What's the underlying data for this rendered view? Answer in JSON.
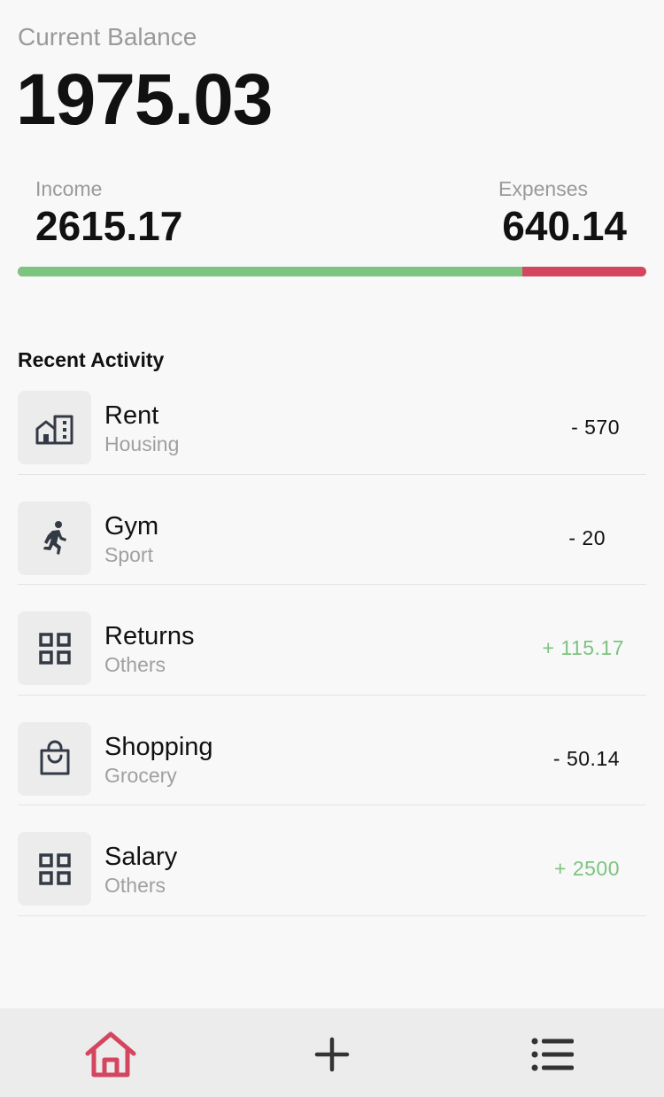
{
  "balance": {
    "label": "Current Balance",
    "value": "1975.03"
  },
  "summary": {
    "income_label": "Income",
    "income_value": "2615.17",
    "expenses_label": "Expenses",
    "expenses_value": "640.14",
    "income_fraction": 0.8034,
    "income_color": "#7cc47f",
    "expense_color": "#d4465f"
  },
  "recent_activity": {
    "title": "Recent Activity",
    "items": [
      {
        "name": "Rent",
        "category": "Housing",
        "amount": "- 570",
        "icon": "building-icon",
        "positive": false
      },
      {
        "name": "Gym",
        "category": "Sport",
        "amount": "- 20",
        "icon": "running-icon",
        "positive": false
      },
      {
        "name": "Returns",
        "category": "Others",
        "amount": "+ 115.17",
        "icon": "grid-icon",
        "positive": true
      },
      {
        "name": "Shopping",
        "category": "Grocery",
        "amount": "- 50.14",
        "icon": "shopping-bag-icon",
        "positive": false
      },
      {
        "name": "Salary",
        "category": "Others",
        "amount": "+ 2500",
        "icon": "grid-icon",
        "positive": true
      }
    ]
  },
  "nav": {
    "items": [
      {
        "icon": "home-icon",
        "active": true
      },
      {
        "icon": "plus-icon",
        "active": false
      },
      {
        "icon": "list-icon",
        "active": false
      }
    ],
    "active_color": "#d4465f",
    "inactive_color": "#333333"
  }
}
